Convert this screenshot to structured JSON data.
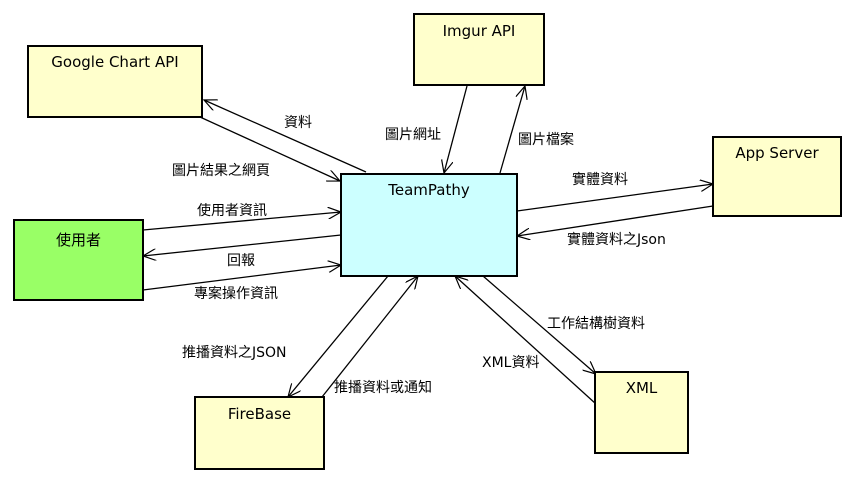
{
  "nodes": {
    "google_chart_api": "Google Chart API",
    "imgur_api": "Imgur API",
    "app_server": "App Server",
    "user": "使用者",
    "teampathy": "TeamPathy",
    "firebase": "FireBase",
    "xml": "XML"
  },
  "edges": {
    "teampathy_to_google_data": "資料",
    "google_to_teampathy_page": "圖片結果之網頁",
    "imgur_to_teampathy_url": "圖片網址",
    "teampathy_to_imgur_file": "圖片檔案",
    "teampathy_to_app_entity": "實體資料",
    "app_to_teampathy_json": "實體資料之Json",
    "user_to_teampathy_info": "使用者資訊",
    "teampathy_to_user_report": "回報",
    "user_to_teampathy_project": "專案操作資訊",
    "teampathy_to_firebase_json": "推播資料之JSON",
    "firebase_to_teampathy_push": "推播資料或通知",
    "teampathy_to_xml_tree": "工作結構樹資料",
    "xml_to_teampathy_data": "XML資料"
  }
}
